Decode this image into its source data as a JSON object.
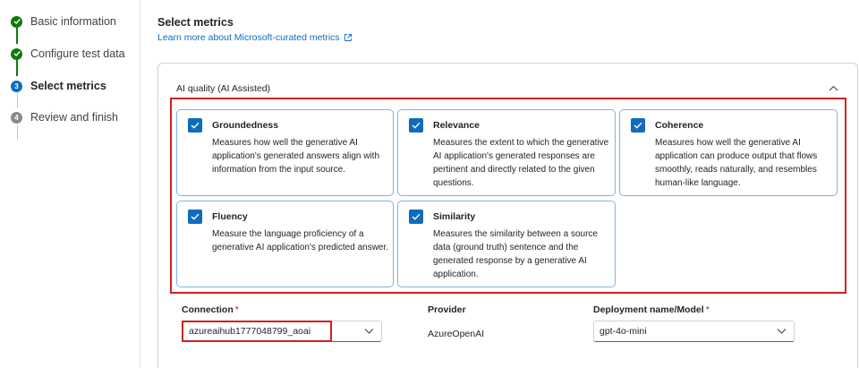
{
  "sidebar": {
    "steps": [
      {
        "label": "Basic information",
        "state": "done",
        "icon": "check-icon"
      },
      {
        "label": "Configure test data",
        "state": "done",
        "icon": "check-icon"
      },
      {
        "label": "Select metrics",
        "state": "current",
        "number": "3"
      },
      {
        "label": "Review and finish",
        "state": "future",
        "number": "4"
      }
    ]
  },
  "main": {
    "title": "Select metrics",
    "learn_link": "Learn more about Microsoft-curated metrics",
    "section_title": "AI quality (AI Assisted)",
    "metrics": [
      {
        "name": "Groundedness",
        "checked": true,
        "description": "Measures how well the generative AI application's generated answers align with information from the input source."
      },
      {
        "name": "Relevance",
        "checked": true,
        "description": "Measures the extent to which the generative AI application's generated responses are pertinent and directly related to the given questions."
      },
      {
        "name": "Coherence",
        "checked": true,
        "description": "Measures how well the generative AI application can produce output that flows smoothly, reads naturally, and resembles human-like language."
      },
      {
        "name": "Fluency",
        "checked": true,
        "description": "Measure the language proficiency of a generative AI application's predicted answer."
      },
      {
        "name": "Similarity",
        "checked": true,
        "description": "Measures the similarity between a source data (ground truth) sentence and the generated response by a generative AI application."
      }
    ],
    "connection": {
      "label": "Connection",
      "required_mark": "*",
      "value": "azureaihub1777048799_aoai"
    },
    "provider": {
      "label": "Provider",
      "value": "AzureOpenAI"
    },
    "deployment": {
      "label": "Deployment name/Model",
      "required_mark": "*",
      "value": "gpt-4o-mini"
    }
  },
  "colors": {
    "accent": "#0f6cbd",
    "success": "#0e7a0d",
    "highlight": "#d32020",
    "card_border": "#7fb2e5"
  }
}
